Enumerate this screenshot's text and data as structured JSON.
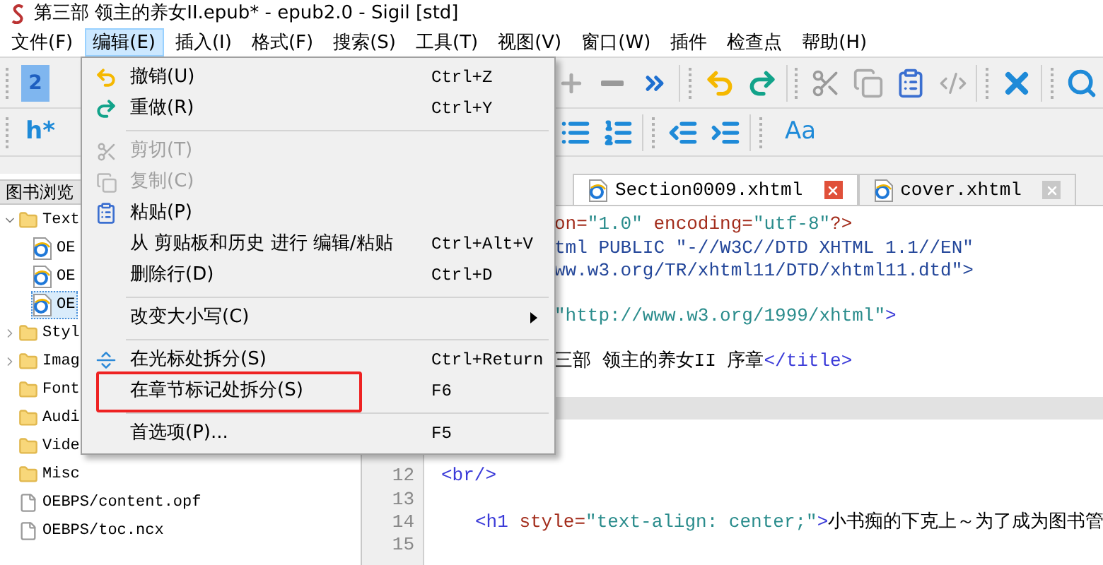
{
  "window": {
    "title": "第三部 领主的养女II.epub* - epub2.0 - Sigil [std]"
  },
  "menubar": [
    {
      "label": "文件(F)",
      "selected": false
    },
    {
      "label": "编辑(E)",
      "selected": true
    },
    {
      "label": "插入(I)",
      "selected": false
    },
    {
      "label": "格式(F)",
      "selected": false
    },
    {
      "label": "搜索(S)",
      "selected": false
    },
    {
      "label": "工具(T)",
      "selected": false
    },
    {
      "label": "视图(V)",
      "selected": false
    },
    {
      "label": "窗口(W)",
      "selected": false
    },
    {
      "label": "插件",
      "selected": false
    },
    {
      "label": "检查点",
      "selected": false
    },
    {
      "label": "帮助(H)",
      "selected": false
    }
  ],
  "toolbar": {
    "heading_doc": "2",
    "heading_menu": "h*",
    "case_menu": "Aa"
  },
  "book_browser": {
    "title": "图书浏览",
    "tree": [
      {
        "label": "Text",
        "kind": "folder",
        "expanded": true,
        "selected": false,
        "children": [
          {
            "label": "OE",
            "kind": "page",
            "selected": false
          },
          {
            "label": "OE",
            "kind": "page",
            "selected": false
          },
          {
            "label": "OE",
            "kind": "page",
            "selected": true
          }
        ]
      },
      {
        "label": "Styl",
        "kind": "folder",
        "expanded": false,
        "selected": false
      },
      {
        "label": "Imag",
        "kind": "folder",
        "expanded": false,
        "selected": false
      },
      {
        "label": "Font",
        "kind": "folder",
        "selected": false
      },
      {
        "label": "Audi",
        "kind": "folder",
        "selected": false
      },
      {
        "label": "Vide",
        "kind": "folder",
        "selected": false
      },
      {
        "label": "Misc",
        "kind": "folder",
        "selected": false
      },
      {
        "label": "OEBPS/content.opf",
        "kind": "file",
        "selected": false
      },
      {
        "label": "OEBPS/toc.ncx",
        "kind": "file",
        "selected": false
      }
    ]
  },
  "editor_tabs": [
    {
      "label": "Section0009.xhtml",
      "selected": true
    },
    {
      "label": "cover.xhtml",
      "selected": false
    }
  ],
  "code_lines": [
    {
      "kind": "clipped",
      "tokens": [
        {
          "kind": "attr",
          "text": "on="
        },
        {
          "kind": "value",
          "text": "\"1.0\""
        },
        {
          "kind": "attr",
          "text": " encoding="
        },
        {
          "kind": "value",
          "text": "\"utf-8\""
        },
        {
          "kind": "attr",
          "text": "?>"
        }
      ]
    },
    {
      "kind": "clipped",
      "tokens": [
        {
          "kind": "doctype",
          "text": "tml PUBLIC \"-//W3C//DTD XHTML 1.1//EN\""
        }
      ]
    },
    {
      "kind": "clipped",
      "tokens": [
        {
          "kind": "doctype",
          "text": "ww.w3.org/TR/xhtml11/DTD/xhtml11.dtd\">"
        }
      ]
    },
    {
      "kind": "plain"
    },
    {
      "kind": "clipped",
      "tokens": [
        {
          "kind": "value",
          "text": "\"http://www.w3.org/1999/xhtml\""
        },
        {
          "kind": "tag",
          "text": ">"
        }
      ]
    },
    {
      "kind": "plain"
    },
    {
      "kind": "clipped",
      "tokens": [
        {
          "kind": "text",
          "text": "三部 领主的养女II 序章"
        },
        {
          "kind": "tag",
          "text": "</title>"
        }
      ]
    },
    {
      "kind": "plain"
    },
    {
      "kind": "current"
    },
    {
      "kind": "plain"
    },
    {
      "kind": "plain"
    },
    {
      "number": "12",
      "kind": "plain",
      "tokens": [
        {
          "kind": "tag",
          "text": "<br/>"
        }
      ]
    },
    {
      "number": "13",
      "kind": "plain"
    },
    {
      "number": "14",
      "kind": "indented",
      "tokens": [
        {
          "kind": "tag",
          "text": "<h1"
        },
        {
          "kind": "attr",
          "text": " style="
        },
        {
          "kind": "value",
          "text": "\"text-align: center;\""
        },
        {
          "kind": "tag",
          "text": ">"
        },
        {
          "kind": "text",
          "text": "小书痴的下克上～为了成为图书管"
        }
      ]
    },
    {
      "number": "15",
      "kind": "plain"
    }
  ],
  "edit_menu": [
    {
      "kind": "item",
      "label": "撤销(U)",
      "shortcut": "Ctrl+Z",
      "disabled": false,
      "marked": false
    },
    {
      "kind": "item",
      "label": "重做(R)",
      "shortcut": "Ctrl+Y",
      "disabled": false,
      "marked": false
    },
    {
      "kind": "separator"
    },
    {
      "kind": "item",
      "label": "剪切(T)",
      "disabled": true,
      "marked": false
    },
    {
      "kind": "item",
      "label": "复制(C)",
      "disabled": true,
      "marked": false
    },
    {
      "kind": "item",
      "label": "粘贴(P)",
      "disabled": false,
      "marked": false
    },
    {
      "kind": "item",
      "label": "从 剪贴板和历史 进行 编辑/粘贴",
      "shortcut": "Ctrl+Alt+V",
      "disabled": false,
      "marked": false
    },
    {
      "kind": "item",
      "label": "删除行(D)",
      "shortcut": "Ctrl+D",
      "disabled": false,
      "marked": false
    },
    {
      "kind": "separator"
    },
    {
      "kind": "submenu",
      "label": "改变大小写(C)",
      "disabled": false,
      "marked": false
    },
    {
      "kind": "separator"
    },
    {
      "kind": "item",
      "label": "在光标处拆分(S)",
      "shortcut": "Ctrl+Return",
      "disabled": false,
      "marked": false
    },
    {
      "kind": "item",
      "label": "在章节标记处拆分(S)",
      "shortcut": "F6",
      "disabled": false,
      "marked": true
    },
    {
      "kind": "separator"
    },
    {
      "kind": "item",
      "label": "首选项(P)...",
      "shortcut": "F5",
      "disabled": false,
      "marked": false
    }
  ]
}
